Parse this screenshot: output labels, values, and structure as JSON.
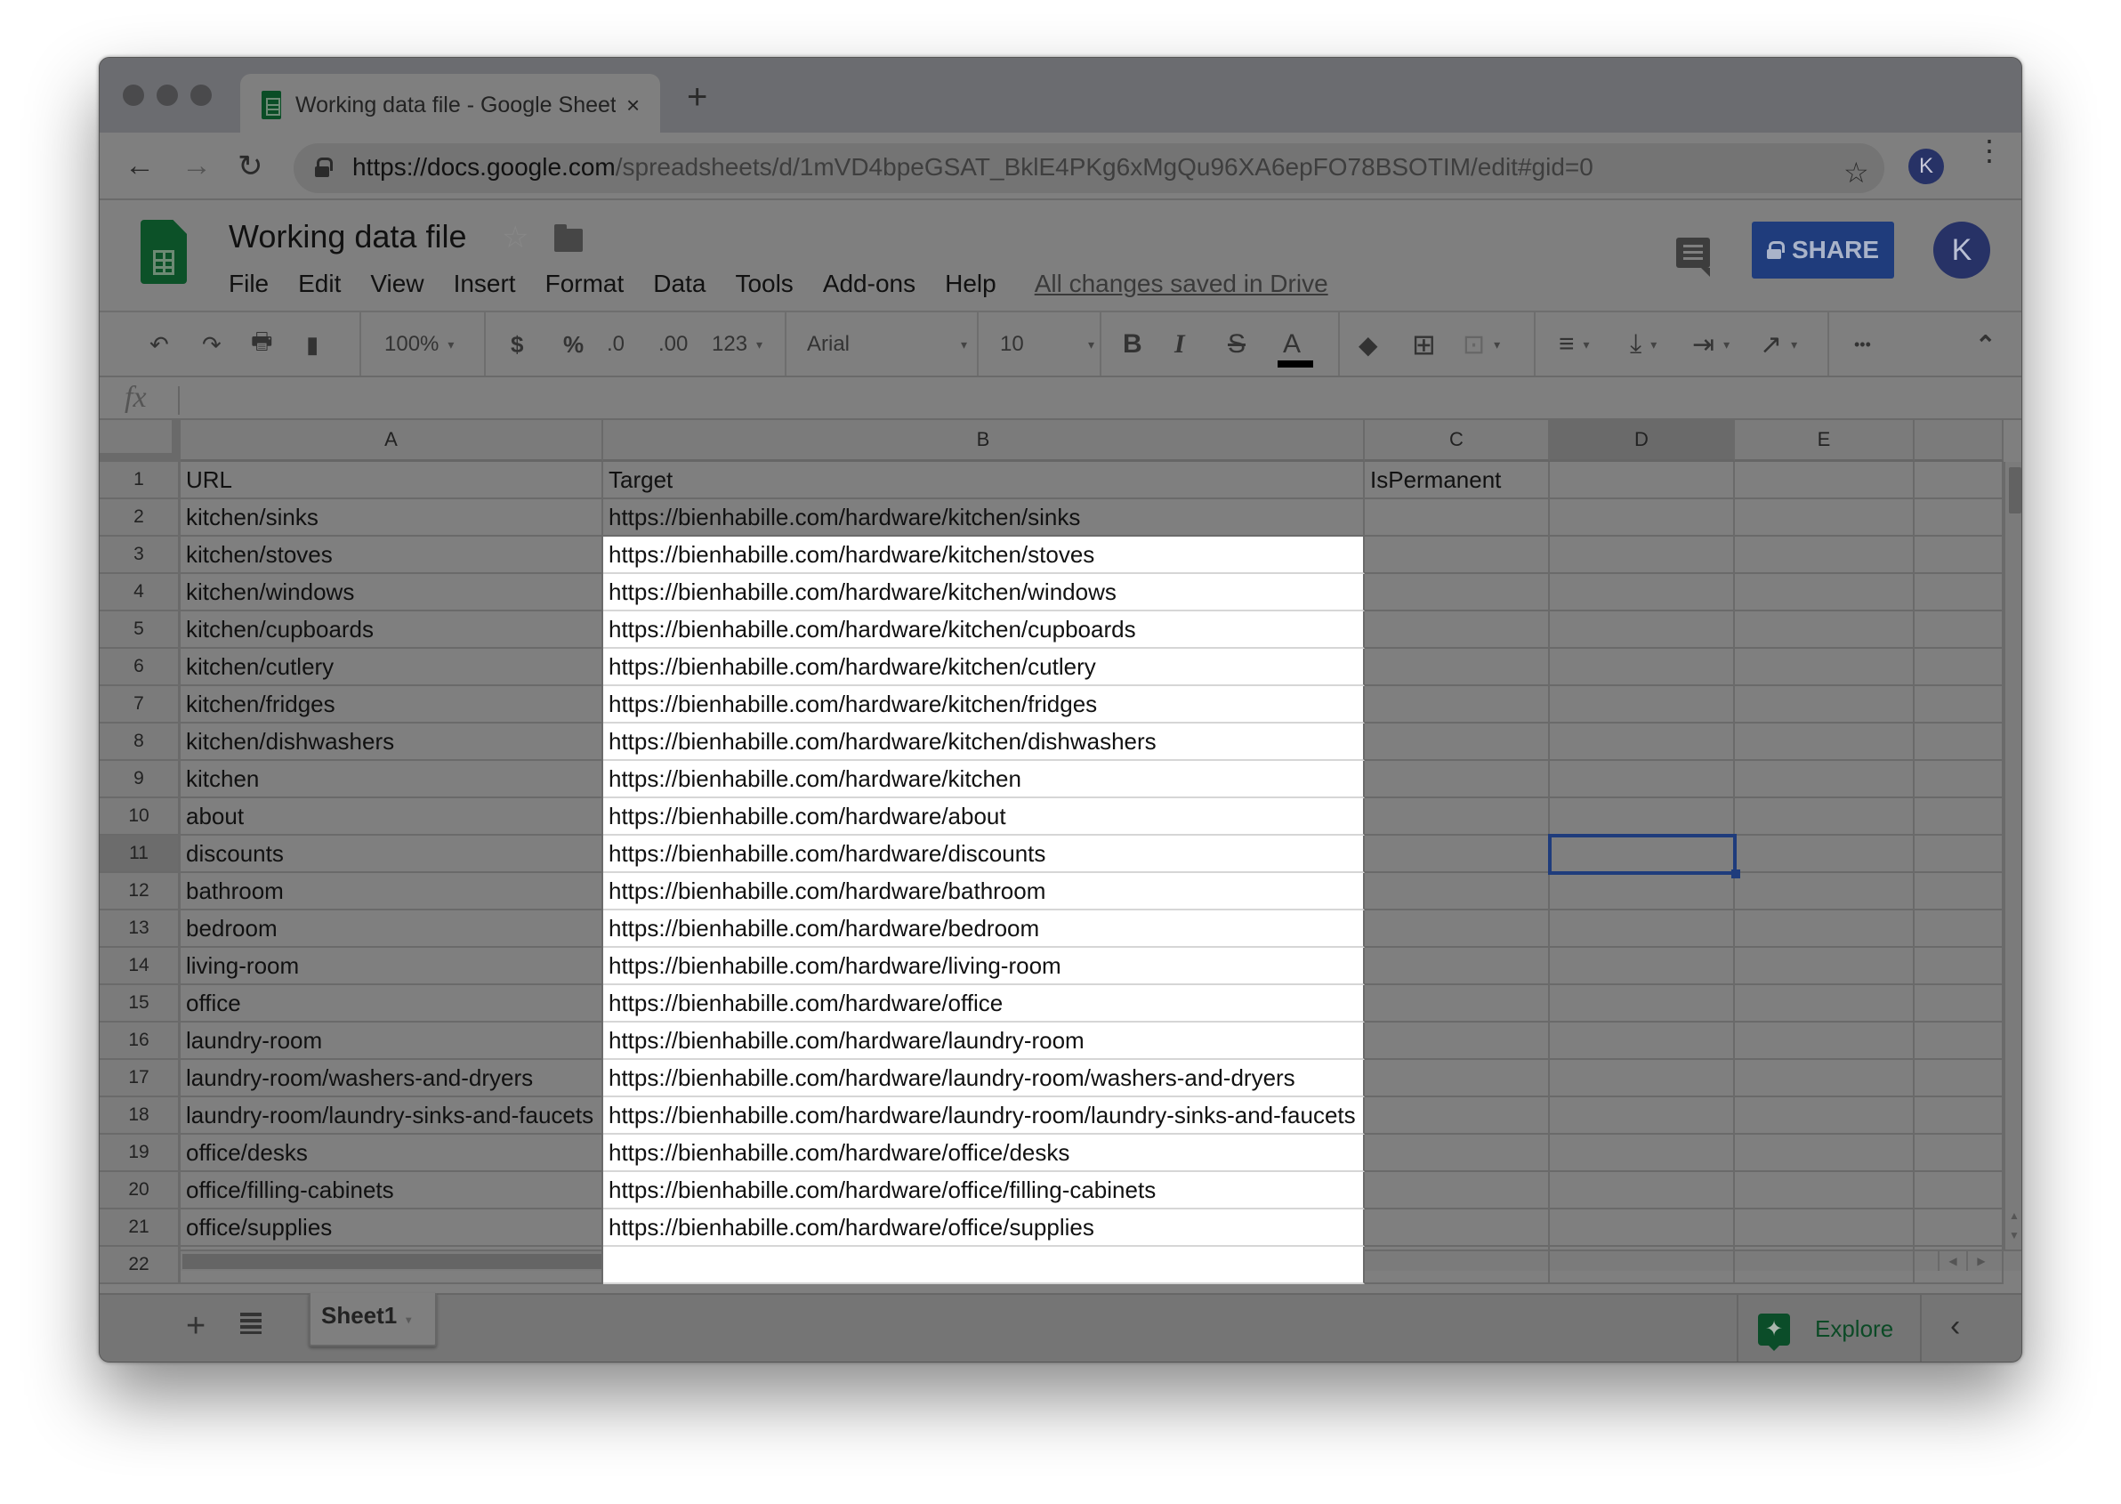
{
  "browser": {
    "tab_title": "Working data file - Google Sheets",
    "tab_close": "×",
    "new_tab": "+",
    "back": "←",
    "forward": "→",
    "reload": "↻",
    "url_host": "https://docs.google.com",
    "url_path": "/spreadsheets/d/1mVD4bpeGSAT_BklE4PKg6xMgQu96XA6epFO78BSOTIM/edit#gid=0",
    "bookmark": "☆",
    "profile_initial": "K",
    "menu": "⋮"
  },
  "doc": {
    "title": "Worki​ng data file",
    "star": "☆",
    "menu": [
      "File",
      "Edit",
      "View",
      "Insert",
      "Format",
      "Data",
      "Tools",
      "Add-ons",
      "Help"
    ],
    "save_status": "All changes saved in Drive",
    "share_label": "SHARE",
    "user_initial": "K"
  },
  "toolbar": {
    "undo": "↶",
    "redo": "↷",
    "print": "🖶",
    "paint_format": "▮",
    "zoom": "100%",
    "currency": "$",
    "percent": "%",
    "decrease_decimals": ".0",
    "increase_decimals": ".00",
    "more_formats": "123",
    "font": "Arial",
    "font_size": "10",
    "bold": "B",
    "italic": "I",
    "strikethrough": "S",
    "text_color": "A",
    "more": "•••",
    "collapse": "⌃",
    "caret": "▾"
  },
  "formula_bar": {
    "fx": "fx",
    "value": ""
  },
  "grid": {
    "columns": [
      "A",
      "B",
      "C",
      "D",
      "E",
      ""
    ],
    "selected_column": "D",
    "selected_row": 11,
    "selected_cell": "D11",
    "rows": [
      {
        "n": "1",
        "a": "URL",
        "b": "Target",
        "c": "IsPermanent"
      },
      {
        "n": "2",
        "a": "kitchen/sinks",
        "b": "https://bienhabille.com/hardware/kitchen/sinks",
        "c": ""
      },
      {
        "n": "3",
        "a": "kitchen/stoves",
        "b": "https://bienhabille.com/hardware/kitchen/stoves",
        "c": ""
      },
      {
        "n": "4",
        "a": "kitchen/windows",
        "b": "https://bienhabille.com/hardware/kitchen/windows",
        "c": ""
      },
      {
        "n": "5",
        "a": "kitchen/cupboards",
        "b": "https://bienhabille.com/hardware/kitchen/cupboards",
        "c": ""
      },
      {
        "n": "6",
        "a": "kitchen/cutlery",
        "b": "https://bienhabille.com/hardware/kitchen/cutlery",
        "c": ""
      },
      {
        "n": "7",
        "a": "kitchen/fridges",
        "b": "https://bienhabille.com/hardware/kitchen/fridges",
        "c": ""
      },
      {
        "n": "8",
        "a": "kitchen/dishwashers",
        "b": "https://bienhabille.com/hardware/kitchen/dishwashers",
        "c": ""
      },
      {
        "n": "9",
        "a": "kitchen",
        "b": "https://bienhabille.com/hardware/kitchen",
        "c": ""
      },
      {
        "n": "10",
        "a": "about",
        "b": "https://bienhabille.com/hardware/about",
        "c": ""
      },
      {
        "n": "11",
        "a": "discounts",
        "b": "https://bienhabille.com/hardware/discounts",
        "c": ""
      },
      {
        "n": "12",
        "a": "bathroom",
        "b": "https://bienhabille.com/hardware/bathroom",
        "c": ""
      },
      {
        "n": "13",
        "a": "bedroom",
        "b": "https://bienhabille.com/hardware/bedroom",
        "c": ""
      },
      {
        "n": "14",
        "a": "living-room",
        "b": "https://bienhabille.com/hardware/living-room",
        "c": ""
      },
      {
        "n": "15",
        "a": "office",
        "b": "https://bienhabille.com/hardware/office",
        "c": ""
      },
      {
        "n": "16",
        "a": "laundry-room",
        "b": "https://bienhabille.com/hardware/laundry-room",
        "c": ""
      },
      {
        "n": "17",
        "a": "laundry-room/washers-and-dryers",
        "b": "https://bienhabille.com/hardware/laundry-room/washers-and-dryers",
        "c": ""
      },
      {
        "n": "18",
        "a": "laundry-room/laundry-sinks-and-faucets",
        "b": "https://bienhabille.com/hardware/laundry-room/laundry-sinks-and-faucets",
        "c": ""
      },
      {
        "n": "19",
        "a": "office/desks",
        "b": "https://bienhabille.com/hardware/office/desks",
        "c": ""
      },
      {
        "n": "20",
        "a": "office/filling-cabinets",
        "b": "https://bienhabille.com/hardware/office/filling-cabinets",
        "c": ""
      },
      {
        "n": "21",
        "a": "office/supplies",
        "b": "https://bienhabille.com/hardware/office/supplies",
        "c": ""
      },
      {
        "n": "22",
        "a": "",
        "b": "",
        "c": ""
      }
    ]
  },
  "sheets": {
    "add": "+",
    "tabs": [
      "Sheet1"
    ],
    "explore_label": "Explore",
    "explore_icon": "✦",
    "side_toggle": "‹"
  },
  "colors": {
    "overlay_gray": "#7f7f7f",
    "share_blue": "#1f3c7c",
    "selection_blue": "#1f3c7c",
    "sheets_green": "#0c5128",
    "highlight_white": "#ffffff"
  }
}
